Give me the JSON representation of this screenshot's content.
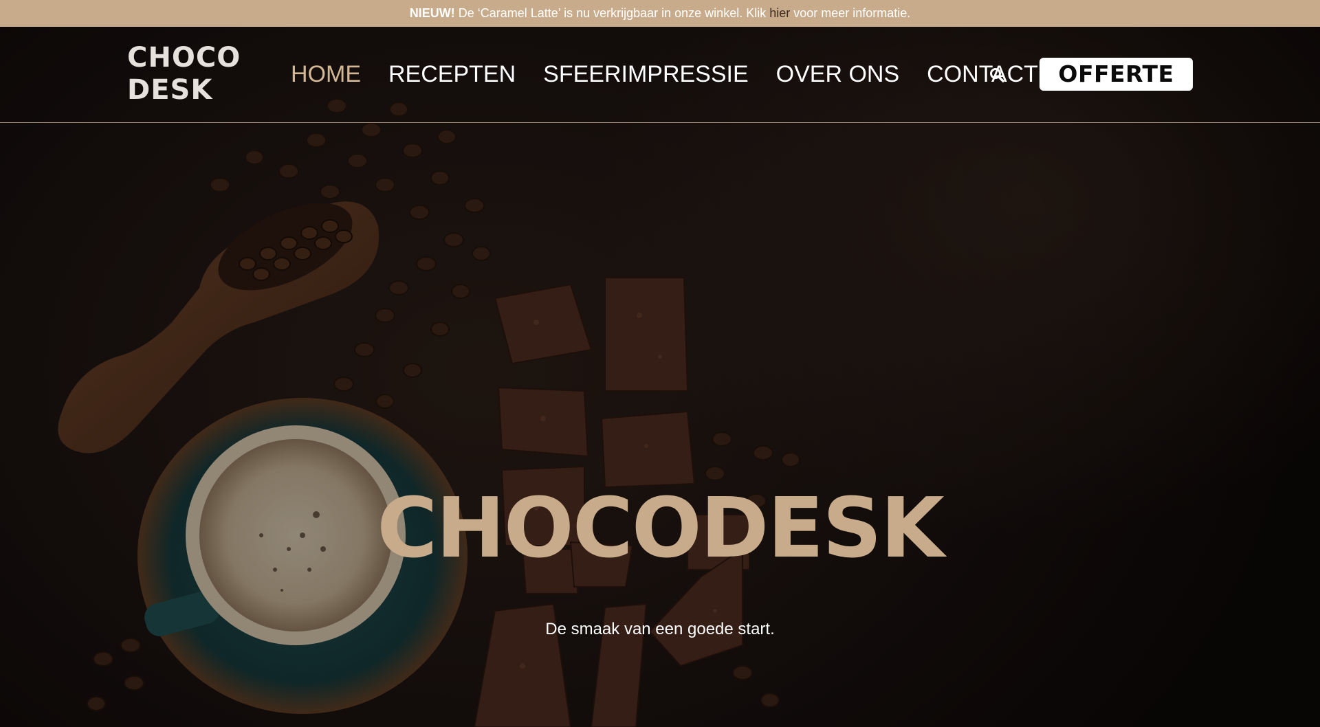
{
  "announcement": {
    "bold": "NIEUW!",
    "text_before": " De ‘Caramel Latte’ is nu verkrijgbaar in onze winkel. Klik ",
    "link": "hier",
    "text_after": " voor meer informatie."
  },
  "logo": {
    "line1": "CHOCO",
    "line2": "DESK"
  },
  "nav": {
    "items": [
      {
        "label": "HOME",
        "active": true
      },
      {
        "label": "RECEPTEN",
        "active": false
      },
      {
        "label": "SFEERIMPRESSIE",
        "active": false
      },
      {
        "label": "OVER ONS",
        "active": false
      },
      {
        "label": "CONTACT",
        "active": false
      }
    ]
  },
  "header": {
    "search_icon": "search-icon",
    "cta_label": "OFFERTE"
  },
  "hero": {
    "title": "CHOCODESK",
    "subtitle": "De smaak van een goede start."
  },
  "colors": {
    "accent": "#c8ab8a",
    "announcement_bg": "#c8ab8a",
    "active_nav": "#d4b795",
    "text_light": "#ffffff",
    "background": "#1a1210"
  }
}
